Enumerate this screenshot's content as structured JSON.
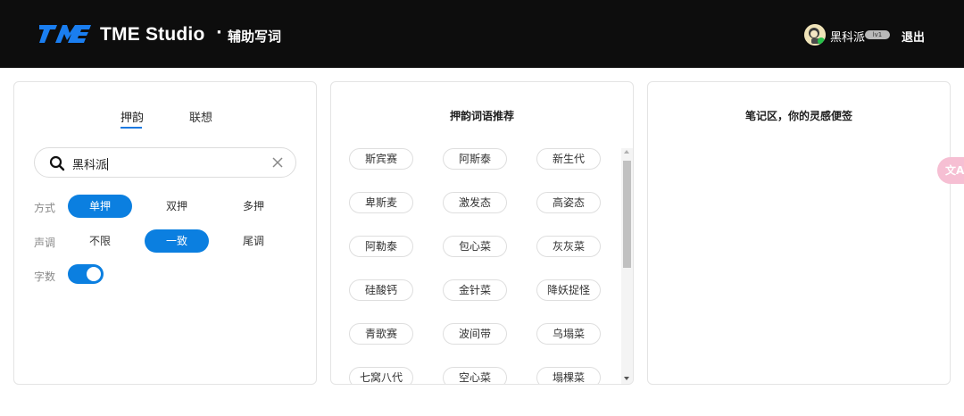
{
  "header": {
    "brand": "TME Studio",
    "separator": "·",
    "subtitle": "辅助写词",
    "user_name": "黑科派",
    "user_badge": "lv1",
    "logout_label": "退出"
  },
  "left_panel": {
    "tabs": [
      {
        "label": "押韵",
        "active": true
      },
      {
        "label": "联想",
        "active": false
      }
    ],
    "search": {
      "value": "黑科派"
    },
    "mode": {
      "label": "方式",
      "options": [
        "单押",
        "双押",
        "多押"
      ],
      "selected": "单押"
    },
    "tone": {
      "label": "声调",
      "options": [
        "不限",
        "一致",
        "尾调"
      ],
      "selected": "一致"
    },
    "word_count": {
      "label": "字数",
      "enabled": true
    }
  },
  "middle_panel": {
    "title": "押韵词语推荐",
    "words": [
      "斯宾赛",
      "阿斯泰",
      "新生代",
      "卑斯麦",
      "激发态",
      "高姿态",
      "阿勒泰",
      "包心菜",
      "灰灰菜",
      "硅酸钙",
      "金针菜",
      "降妖捉怪",
      "青歌赛",
      "波间带",
      "乌塌菜",
      "七窝八代",
      "空心菜",
      "塌棵菜"
    ]
  },
  "right_panel": {
    "title": "笔记区，你的灵感便签"
  },
  "floating": {
    "translate_icon": "translate-icon",
    "glyph": "文A"
  },
  "colors": {
    "accent": "#0b7fe0",
    "header_bg": "#0d0d0d",
    "floating_button": "#f6bfd3"
  }
}
